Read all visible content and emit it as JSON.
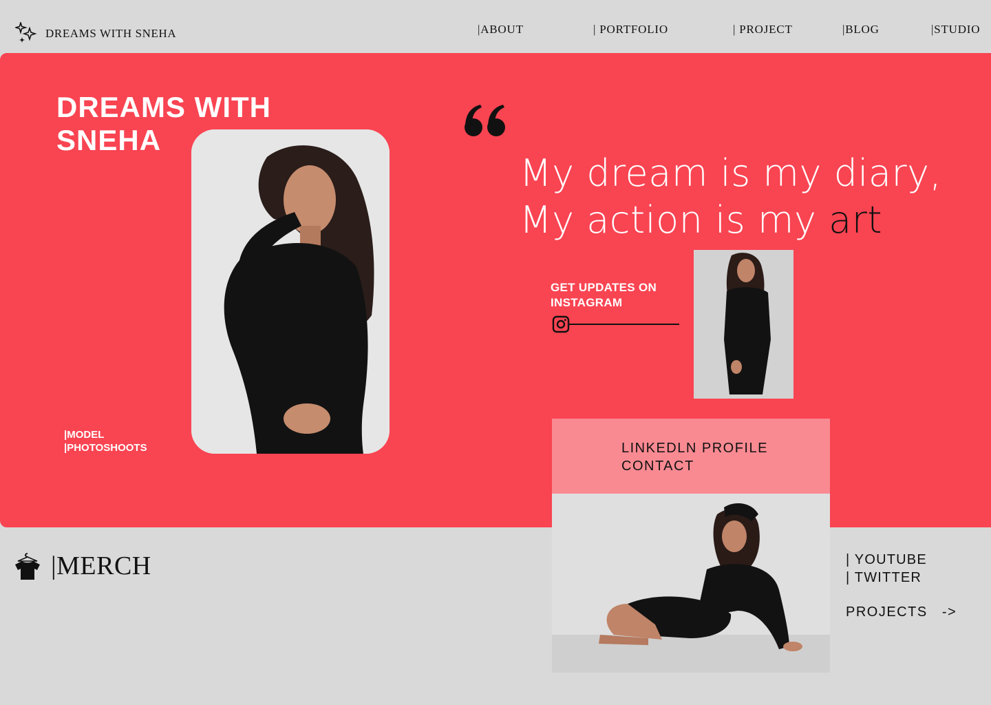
{
  "header": {
    "brand": "DREAMS WITH SNEHA",
    "brand_icon": "sparkles-icon",
    "nav": [
      "|ABOUT",
      "| PORTFOLIO",
      "| PROJECT",
      "|BLOG",
      "|STUDIO"
    ]
  },
  "hero": {
    "background": "#f94452",
    "title": "DREAMS WITH SNEHA",
    "tags": [
      "|MODEL",
      "|PHOTOSHOOTS"
    ],
    "quote_line1": "My dream is my diary,",
    "quote_line2_lead": "My action is my",
    "quote_line2_accent": "art",
    "quote_icon": "quote-mark-icon",
    "instagram": {
      "label": "GET UPDATES ON INSTAGRAM",
      "icon": "instagram-icon"
    },
    "contact": {
      "line1": "LINKEDLN PROFILE",
      "line2": "CONTACT",
      "background": "#f98a92"
    }
  },
  "footer": {
    "merch_label": "|MERCH",
    "merch_icon": "tshirt-hanger-icon",
    "socials": [
      "| YOUTUBE",
      "| TWITTER"
    ],
    "projects_link": "PROJECTS   ->"
  }
}
